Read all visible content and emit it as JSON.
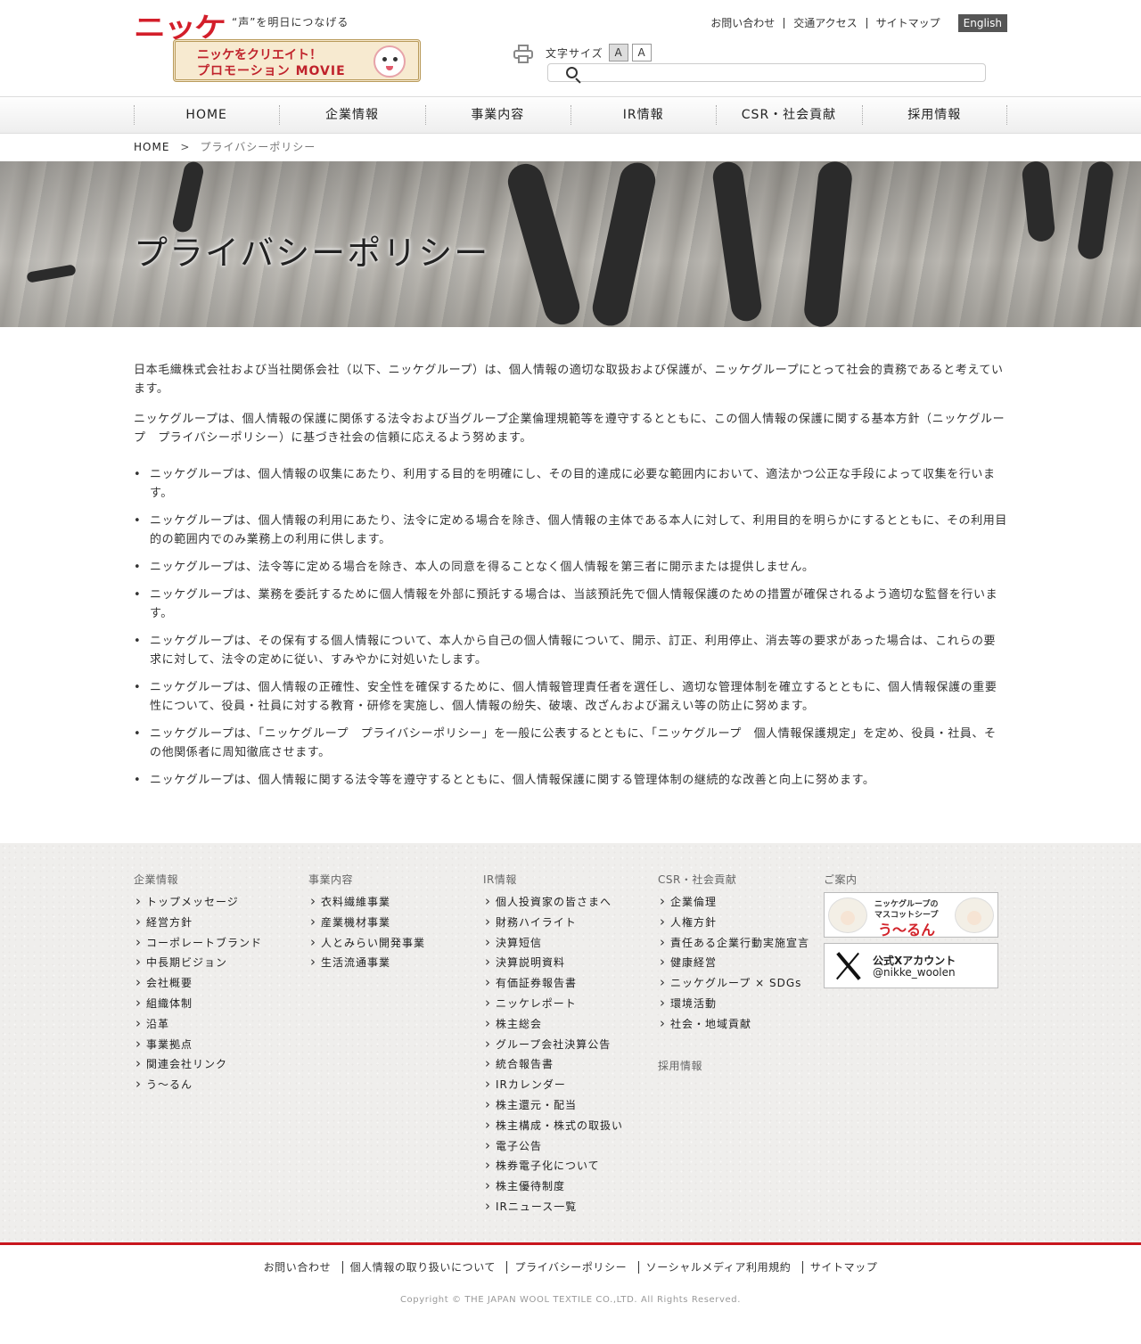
{
  "header": {
    "logo_text": "ニッケ",
    "tagline": "“声”を明日につなげる",
    "promo_line1": "ニッケをクリエイト！",
    "promo_line2": "プロモーション MOVIE",
    "top_links": [
      "お問い合わせ",
      "交通アクセス",
      "サイトマップ"
    ],
    "english_label": "English",
    "fontsize_label": "文字サイズ",
    "fontsize_small": "A",
    "fontsize_large": "A",
    "search_placeholder": ""
  },
  "nav": [
    "HOME",
    "企業情報",
    "事業内容",
    "IR情報",
    "CSR・社会貢献",
    "採用情報"
  ],
  "breadcrumb": {
    "home": "HOME",
    "separator": ">",
    "current": "プライバシーポリシー"
  },
  "hero": {
    "title": "プライバシーポリシー"
  },
  "content": {
    "paragraphs": [
      "日本毛織株式会社および当社関係会社（以下、ニッケグループ）は、個人情報の適切な取扱および保護が、ニッケグループにとって社会的責務であると考えています。",
      "ニッケグループは、個人情報の保護に関係する法令および当グループ企業倫理規範等を遵守するとともに、この個人情報の保護に関する基本方針（ニッケグループ　プライバシーポリシー）に基づき社会の信頼に応えるよう努めます。"
    ],
    "items": [
      "ニッケグループは、個人情報の収集にあたり、利用する目的を明確にし、その目的達成に必要な範囲内において、適法かつ公正な手段によって収集を行います。",
      "ニッケグループは、個人情報の利用にあたり、法令に定める場合を除き、個人情報の主体である本人に対して、利用目的を明らかにするとともに、その利用目的の範囲内でのみ業務上の利用に供します。",
      "ニッケグループは、法令等に定める場合を除き、本人の同意を得ることなく個人情報を第三者に開示または提供しません。",
      "ニッケグループは、業務を委託するために個人情報を外部に預託する場合は、当該預託先で個人情報保護のための措置が確保されるよう適切な監督を行います。",
      "ニッケグループは、その保有する個人情報について、本人から自己の個人情報について、開示、訂正、利用停止、消去等の要求があった場合は、これらの要求に対して、法令の定めに従い、すみやかに対処いたします。",
      "ニッケグループは、個人情報の正確性、安全性を確保するために、個人情報管理責任者を選任し、適切な管理体制を確立するとともに、個人情報保護の重要性について、役員・社員に対する教育・研修を実施し、個人情報の紛失、破壊、改ざんおよび漏えい等の防止に努めます。",
      "ニッケグループは、「ニッケグループ　プライバシーポリシー」を一般に公表するとともに、「ニッケグループ　個人情報保護規定」を定め、役員・社員、その他関係者に周知徹底させます。",
      "ニッケグループは、個人情報に関する法令等を遵守するとともに、個人情報保護に関する管理体制の継続的な改善と向上に努めます。"
    ]
  },
  "footer": {
    "columns": [
      {
        "title": "企業情報",
        "links": [
          "トップメッセージ",
          "経営方針",
          "コーポレートブランド",
          "中長期ビジョン",
          "会社概要",
          "組織体制",
          "沿革",
          "事業拠点",
          "関連会社リンク",
          "う～るん"
        ]
      },
      {
        "title": "事業内容",
        "links": [
          "衣料繊維事業",
          "産業機材事業",
          "人とみらい開発事業",
          "生活流通事業"
        ]
      },
      {
        "title": "IR情報",
        "links": [
          "個人投資家の皆さまへ",
          "財務ハイライト",
          "決算短信",
          "決算説明資料",
          "有価証券報告書",
          "ニッケレポート",
          "株主総会",
          "グループ会社決算公告",
          "統合報告書",
          "IRカレンダー",
          "株主還元・配当",
          "株主構成・株式の取扱い",
          "電子公告",
          "株券電子化について",
          "株主優待制度",
          "IRニュース一覧"
        ]
      },
      {
        "title": "CSR・社会貢献",
        "links": [
          "企業倫理",
          "人権方針",
          "責任ある企業行動実施宣言",
          "健康経営",
          "ニッケグループ × SDGs",
          "環境活動",
          "社会・地域貢献"
        ],
        "subtitle": "採用情報"
      }
    ],
    "guide_title": "ご案内",
    "banner1_line1": "ニッケグループの",
    "banner1_line2": "マスコットシープ",
    "banner1_line3": "う～るん",
    "banner2_line1": "公式Xアカウント",
    "banner2_line2": "@nikke_woolen",
    "bottom_links": [
      "お問い合わせ",
      "個人情報の取り扱いについて",
      "プライバシーポリシー",
      "ソーシャルメディア利用規約",
      "サイトマップ"
    ],
    "copyright": "Copyright © THE JAPAN WOOL TEXTILE CO.,LTD. All Rights Reserved."
  },
  "colors": {
    "brand_red": "#d31e2a",
    "footer_bg": "#efeeec",
    "english_bg": "#555555"
  }
}
